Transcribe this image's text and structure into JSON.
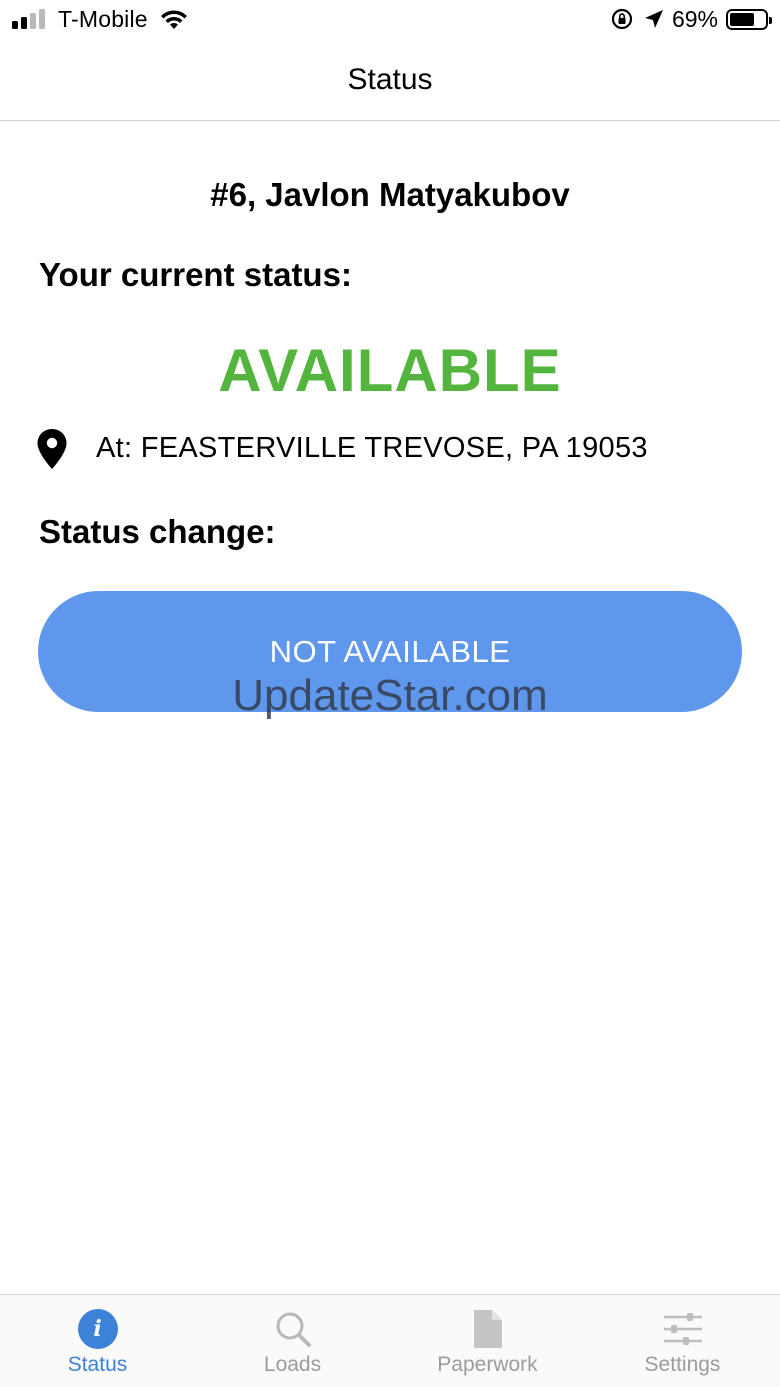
{
  "status_bar": {
    "carrier": "T-Mobile",
    "battery_percent": "69%",
    "battery_level": 0.69,
    "signal_bars": 2
  },
  "nav": {
    "title": "Status"
  },
  "driver": {
    "label": "#6, Javlon Matyakubov"
  },
  "current_status": {
    "label": "Your current status:",
    "value": "AVAILABLE",
    "value_color": "#53b53d"
  },
  "location": {
    "icon": "map-pin-icon",
    "text": "At: FEASTERVILLE TREVOSE, PA 19053"
  },
  "status_change": {
    "label": "Status change:",
    "button_label": "NOT AVAILABLE",
    "button_color": "#5f97ec"
  },
  "watermark": "UpdateStar.com",
  "tabs": [
    {
      "label": "Status",
      "icon": "info-icon",
      "active": true
    },
    {
      "label": "Loads",
      "icon": "search-icon",
      "active": false
    },
    {
      "label": "Paperwork",
      "icon": "document-icon",
      "active": false
    },
    {
      "label": "Settings",
      "icon": "sliders-icon",
      "active": false
    }
  ],
  "accent_color": "#3d82d9"
}
